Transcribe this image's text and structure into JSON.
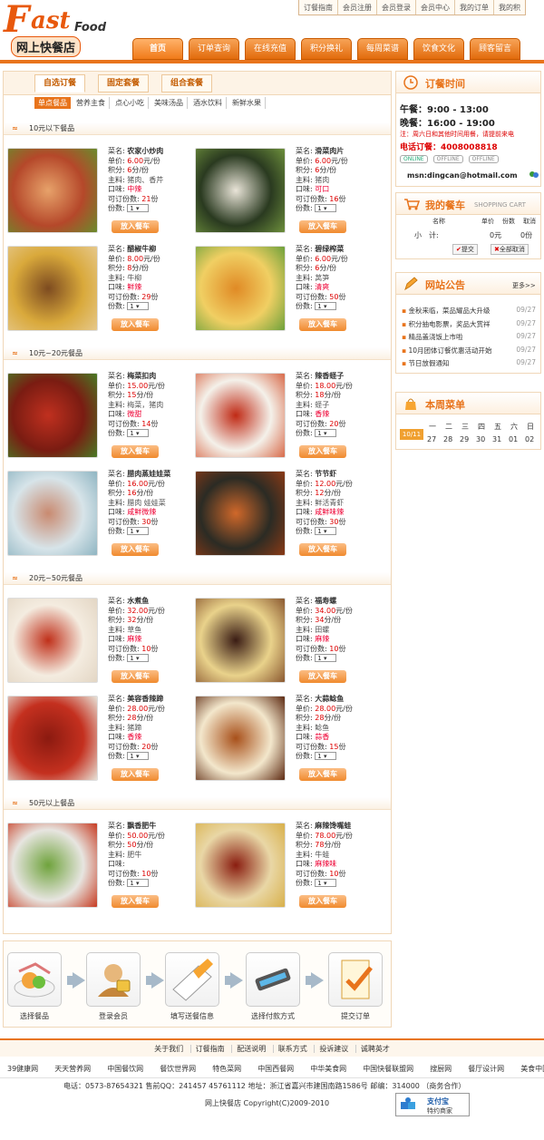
{
  "logo": {
    "f": "F",
    "ast": "ast",
    "food": "Food",
    "cn": "网上快餐店"
  },
  "top_links": [
    "订餐指南",
    "会员注册",
    "会员登录",
    "会员中心",
    "我的订单",
    "我的积"
  ],
  "nav": [
    "首页",
    "订单查询",
    "在线充值",
    "积分换礼",
    "每周菜谱",
    "饮食文化",
    "顾客留言"
  ],
  "tabs": [
    "自选订餐",
    "固定套餐",
    "组合套餐"
  ],
  "subcats": [
    "单点餐品",
    "营养主食",
    "点心小吃",
    "美味汤品",
    "酒水饮料",
    "新鲜水果"
  ],
  "labels": {
    "name": "菜名:",
    "price": "单价:",
    "points": "积分:",
    "main": "主料:",
    "taste": "口味:",
    "avail": "可订份数:",
    "qty": "份数:",
    "add": "放入餐车",
    "yuan": "元/份",
    "fen": "分/份",
    "fen2": "份"
  },
  "sections": [
    {
      "title": "10元以下餐品",
      "dishes": [
        {
          "name": "农家小炒肉",
          "price": "6.00",
          "points": "6",
          "main": "猪肉、香芹",
          "taste": "中辣",
          "avail": "21",
          "qty": "1"
        },
        {
          "name": "滑菜肉片",
          "price": "6.00",
          "points": "6",
          "main": "猪肉",
          "taste": "可口",
          "avail": "16",
          "qty": "1"
        },
        {
          "name": "醋椒牛柳",
          "price": "8.00",
          "points": "8",
          "main": "牛柳",
          "taste": "鲜辣",
          "avail": "29",
          "qty": "1"
        },
        {
          "name": "碧绿榨菜",
          "price": "6.00",
          "points": "6",
          "main": "莴笋",
          "taste": "清爽",
          "avail": "50",
          "qty": "1"
        }
      ]
    },
    {
      "title": "10元~20元餐品",
      "dishes": [
        {
          "name": "梅菜扣肉",
          "price": "15.00",
          "points": "15",
          "main": "梅菜，猪肉",
          "taste": "微甜",
          "avail": "14",
          "qty": "1"
        },
        {
          "name": "辣香蛏子",
          "price": "18.00",
          "points": "18",
          "main": "蛏子",
          "taste": "香辣",
          "avail": "20",
          "qty": "1"
        },
        {
          "name": "腊肉蒸娃娃菜",
          "price": "16.00",
          "points": "16",
          "main": "腊肉 娃娃菜",
          "taste": "咸鲜微辣",
          "avail": "30",
          "qty": "1"
        },
        {
          "name": "节节虾",
          "price": "12.00",
          "points": "12",
          "main": "鲜活青虾",
          "taste": "咸鲜味辣",
          "avail": "30",
          "qty": "1"
        }
      ]
    },
    {
      "title": "20元~50元餐品",
      "dishes": [
        {
          "name": "水煮鱼",
          "price": "32.00",
          "points": "32",
          "main": "草鱼",
          "taste": "麻辣",
          "avail": "10",
          "qty": "1"
        },
        {
          "name": "福寿螺",
          "price": "34.00",
          "points": "34",
          "main": "田螺",
          "taste": "麻辣",
          "avail": "10",
          "qty": "1"
        },
        {
          "name": "美容香辣蹄",
          "price": "28.00",
          "points": "28",
          "main": "猪蹄",
          "taste": "香辣",
          "avail": "20",
          "qty": "1"
        },
        {
          "name": "大蒜鲶鱼",
          "price": "28.00",
          "points": "28",
          "main": "鲶鱼",
          "taste": "蒜香",
          "avail": "15",
          "qty": "1"
        }
      ]
    },
    {
      "title": "50元以上餐品",
      "dishes": [
        {
          "name": "飘香肥牛",
          "price": "50.00",
          "points": "50",
          "main": "肥牛",
          "taste": "",
          "avail": "10",
          "qty": "1"
        },
        {
          "name": "麻辣馋嘴蛙",
          "price": "78.00",
          "points": "78",
          "main": "牛蛙",
          "taste": "麻辣味",
          "avail": "10",
          "qty": "1"
        }
      ]
    }
  ],
  "steps": [
    "选择餐品",
    "登录会员",
    "填写送餐信息",
    "选择付款方式",
    "提交订单"
  ],
  "order_time": {
    "title": "订餐时间",
    "lunch": "午餐：9:00 - 13:00",
    "dinner": "晚餐：16:00 - 19:00",
    "note": "注：周六日和其他时间用餐，请提前来电",
    "phone": "电话订餐：4008008818",
    "online": "ONLINE",
    "offline": "OFFLINE",
    "msn": "msn:dingcan@hotmail.com"
  },
  "cart": {
    "title": "我的餐车",
    "en": "SHOPPING CART",
    "cols": [
      "名称",
      "单价",
      "份数",
      "取消"
    ],
    "subtotal_label": "小　计:",
    "subtotal_price": "0元",
    "subtotal_qty": "0份",
    "submit": "提交",
    "clear": "全部取消"
  },
  "notice": {
    "title": "网站公告",
    "more": "更多>>",
    "items": [
      {
        "text": "金秋来临，菜品耀品大升级",
        "date": "09/27"
      },
      {
        "text": "积分抽电影票，奖品大赏祥",
        "date": "09/27"
      },
      {
        "text": "精品盖浇饭上市啦",
        "date": "09/27"
      },
      {
        "text": "10月团体订餐优惠活动开始",
        "date": "09/27"
      },
      {
        "text": "节日放假通知",
        "date": "09/27"
      }
    ]
  },
  "menu": {
    "title": "本周菜单",
    "today": "10/11",
    "days": [
      "一",
      "二",
      "三",
      "四",
      "五",
      "六",
      "日"
    ],
    "dates": [
      "27",
      "28",
      "29",
      "30",
      "31",
      "01",
      "02"
    ]
  },
  "footer_links": [
    "关于我们",
    "订餐指南",
    "配送说明",
    "联系方式",
    "投诉建议",
    "诚聘英才"
  ],
  "partners": [
    "39健康网",
    "天天营养网",
    "中国餐饮网",
    "餐饮世界网",
    "特色菜网",
    "中国西餐网",
    "中华美食网",
    "中国快餐联盟网",
    "搜厨网",
    "餐厅设计网",
    "美食中国"
  ],
  "address": "电话：0573-87654321 售前QQ：241457 45761112 地址：浙江省嘉兴市建国南路1586号 邮编：314000 （商务合作）",
  "copyright": "网上快餐店 Copyright(C)2009-2010",
  "alipay": {
    "top": "支付宝",
    "bottom": "特约商家"
  },
  "colors": {
    "accent": "#e8741c",
    "price_red": "#dd0000"
  }
}
